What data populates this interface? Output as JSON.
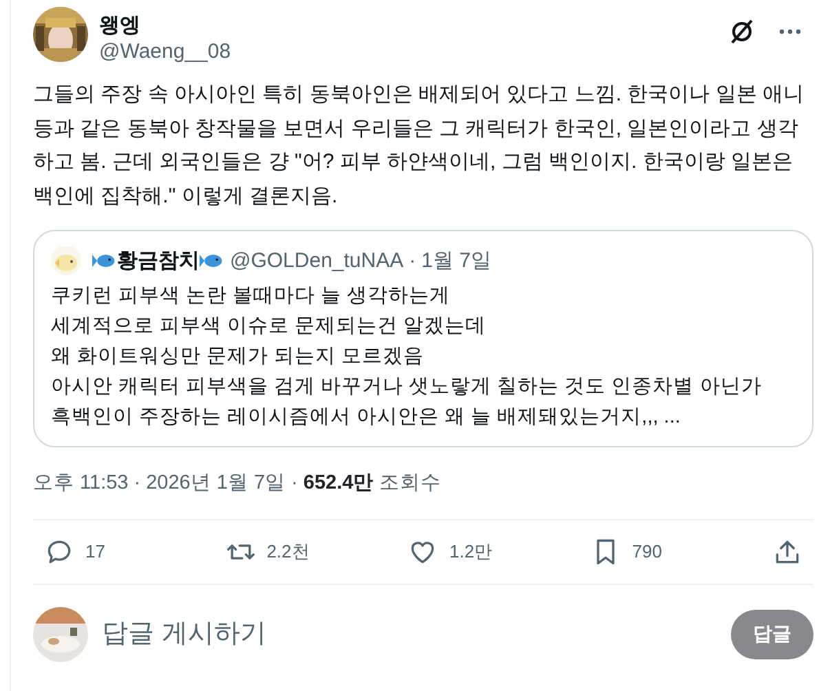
{
  "author": {
    "name": "왱엥",
    "handle": "@Waeng__08"
  },
  "body": "그들의 주장 속 아시아인 특히 동북아인은 배제되어 있다고 느낌. 한국이나 일본 애니 등과 같은 동북아 창작물을 보면서 우리들은 그 캐릭터가 한국인, 일본인이라고 생각하고 봄. 근데 외국인들은 걍 \"어? 피부 하얀색이네, 그럼 백인이지. 한국이랑 일본은 백인에 집착해.\" 이렇게 결론지음.",
  "quote": {
    "name": "황금참치",
    "handle": "@GOLDen_tuNAA",
    "separator": "·",
    "date": "1월 7일",
    "lines": [
      "쿠키런 피부색 논란 볼때마다 늘 생각하는게",
      "세계적으로 피부색 이슈로 문제되는건 알겠는데",
      "왜 화이트워싱만 문제가 되는지 모르겠음",
      "아시안 캐릭터 피부색을 검게 바꾸거나 샛노랗게 칠하는 것도 인종차별 아닌가",
      "흑백인이 주장하는 레이시즘에서 아시안은 왜 늘 배제돼있는거지,,, ..."
    ]
  },
  "meta": {
    "time": "오후 11:53",
    "sep1": "·",
    "date": "2026년 1월 7일",
    "sep2": "·",
    "views": "652.4만",
    "views_label": "조회수"
  },
  "actions": [
    {
      "kind": "reply",
      "count": "17"
    },
    {
      "kind": "repost",
      "count": "2.2천"
    },
    {
      "kind": "like",
      "count": "1.2만"
    },
    {
      "kind": "bookmark",
      "count": "790"
    },
    {
      "kind": "share"
    }
  ],
  "composer": {
    "placeholder": "답글 게시하기",
    "button": "답글",
    "disabled": true
  }
}
